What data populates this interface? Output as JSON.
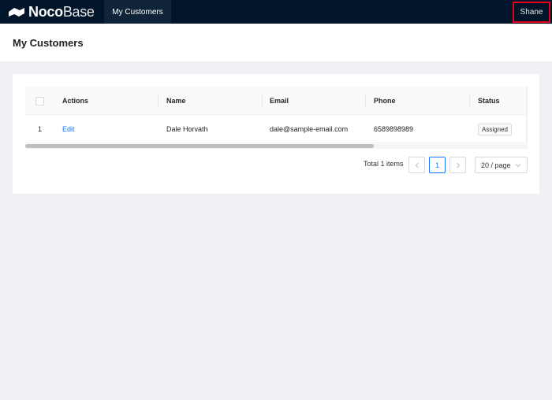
{
  "header": {
    "brand_bold": "Noco",
    "brand_light": "Base",
    "nav_tab": "My Customers",
    "user": "Shane"
  },
  "page": {
    "title": "My Customers"
  },
  "table": {
    "columns": [
      "",
      "Actions",
      "Name",
      "Email",
      "Phone",
      "Status"
    ],
    "rows": [
      {
        "index": "1",
        "action": "Edit",
        "name": "Dale Horvath",
        "email": "dale@sample-email.com",
        "phone": "6589898989",
        "status": "Assigned"
      }
    ]
  },
  "pagination": {
    "total": "Total 1 items",
    "current": "1",
    "page_size": "20 / page"
  },
  "colors": {
    "topbar": "#001529",
    "accent": "#1677ff",
    "highlight_box": "#e8001c"
  },
  "icons": [
    "nocobase-logo-icon",
    "chevron-left-icon",
    "chevron-right-icon",
    "chevron-down-icon"
  ]
}
